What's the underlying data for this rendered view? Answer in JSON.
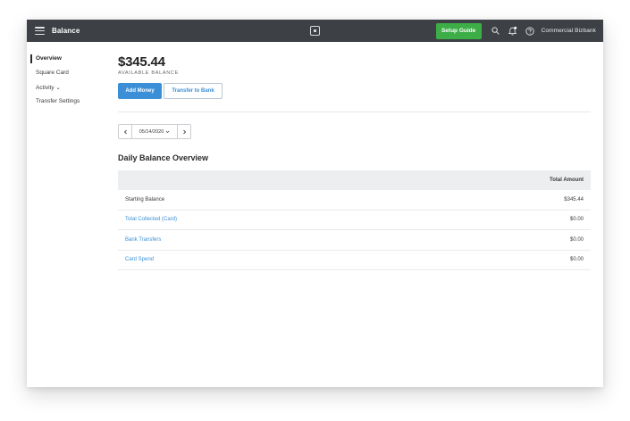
{
  "header": {
    "title": "Balance",
    "setup_label": "Setup Guide",
    "account_name": "Commercial Bizbank",
    "icons": [
      "menu-icon",
      "square-logo-icon",
      "search-icon",
      "bell-icon",
      "help-icon"
    ]
  },
  "sidebar": {
    "items": [
      {
        "label": "Overview",
        "active": true
      },
      {
        "label": "Square Card"
      },
      {
        "label": "Activity ⌄"
      },
      {
        "label": "Transfer Settings"
      }
    ]
  },
  "main": {
    "balance_amount": "$345.44",
    "balance_label": "AVAILABLE BALANCE",
    "add_money_label": "Add Money",
    "transfer_label": "Transfer to Bank",
    "date": "05/14/2020",
    "section_title": "Daily Balance Overview",
    "table": {
      "header": "Total Amount",
      "rows": [
        {
          "label": "Starting Balance",
          "value": "$345.44"
        },
        {
          "label": "Total Collected (Card)",
          "value": "$0.00"
        },
        {
          "label": "Bank Transfers",
          "value": "$0.00"
        },
        {
          "label": "Card Spend",
          "value": "$0.00"
        }
      ]
    }
  },
  "colors": {
    "topbar": "#3d4145",
    "setup_green": "#3dae47",
    "primary_blue": "#3a8fd6",
    "table_header_bg": "#eceeef"
  }
}
